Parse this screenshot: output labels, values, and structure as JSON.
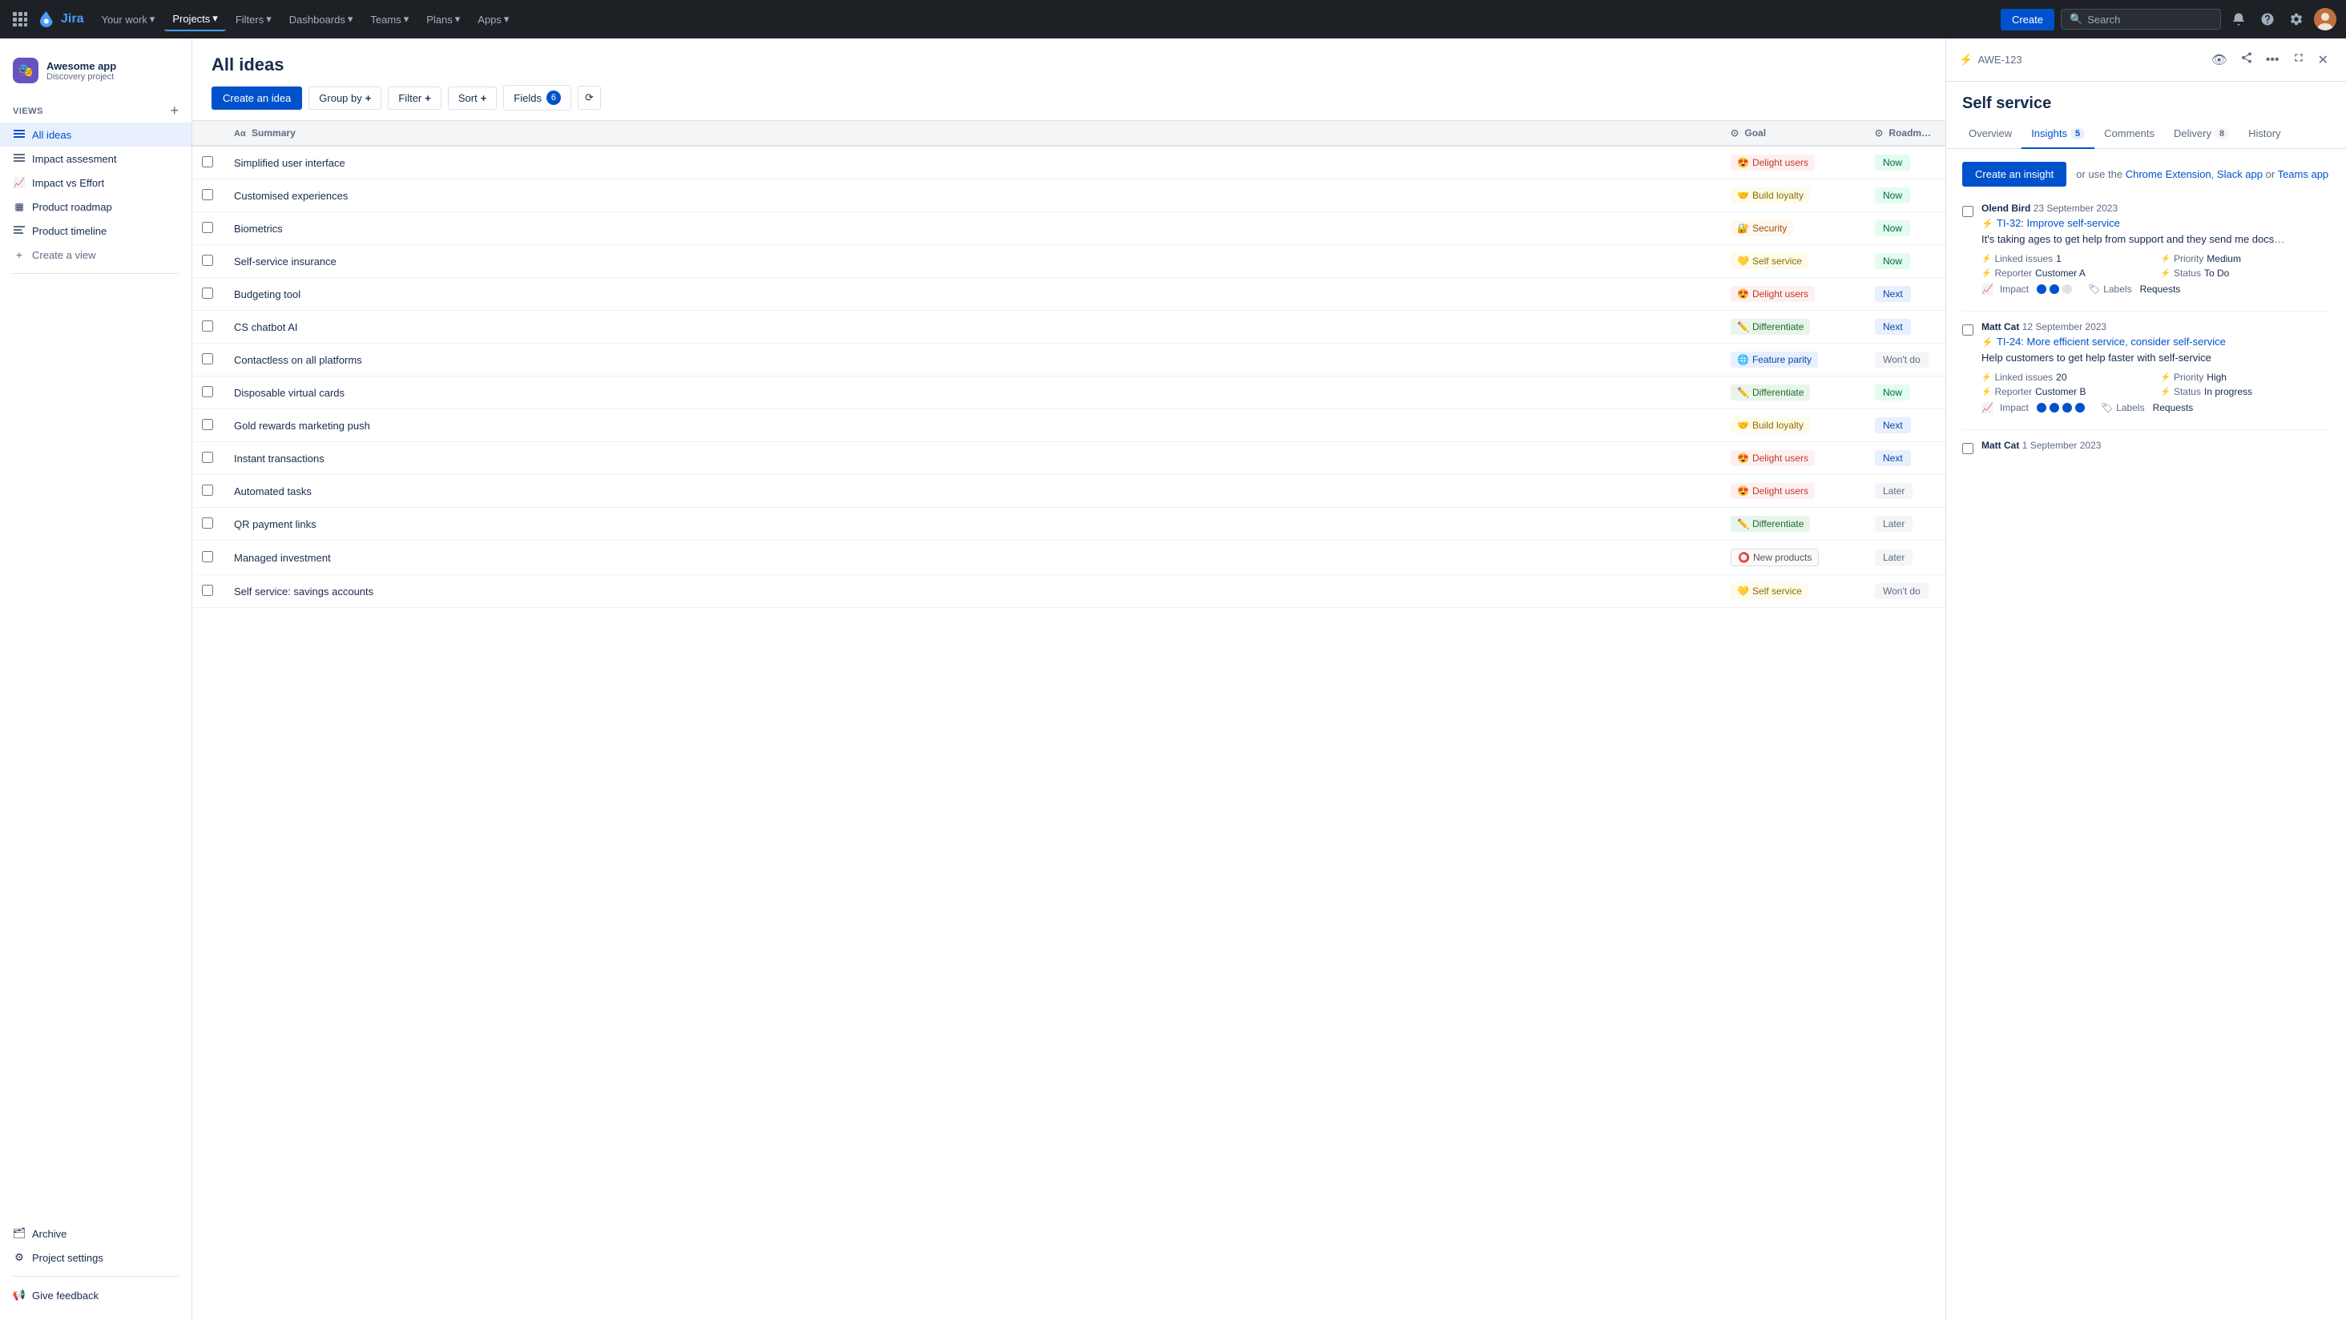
{
  "topnav": {
    "logo_text": "Jira",
    "nav_items": [
      {
        "label": "Your work",
        "dropdown": true
      },
      {
        "label": "Projects",
        "dropdown": true
      },
      {
        "label": "Filters",
        "dropdown": true
      },
      {
        "label": "Dashboards",
        "dropdown": true
      },
      {
        "label": "Teams",
        "dropdown": true
      },
      {
        "label": "Plans",
        "dropdown": true
      },
      {
        "label": "Apps",
        "dropdown": true
      }
    ],
    "create_label": "Create",
    "search_placeholder": "Search"
  },
  "sidebar": {
    "project_icon": "🎭",
    "project_name": "Awesome app",
    "project_sub": "Discovery project",
    "views_label": "VIEWS",
    "views_add_icon": "+",
    "nav_items": [
      {
        "id": "all-ideas",
        "label": "All ideas",
        "icon": "≡",
        "active": true
      },
      {
        "id": "impact-assessment",
        "label": "Impact assesment",
        "icon": "≡"
      },
      {
        "id": "impact-vs-effort",
        "label": "Impact vs Effort",
        "icon": "📈"
      },
      {
        "id": "product-roadmap",
        "label": "Product roadmap",
        "icon": "▦"
      },
      {
        "id": "product-timeline",
        "label": "Product timeline",
        "icon": "≡"
      },
      {
        "id": "create-view",
        "label": "Create a view",
        "icon": "+"
      }
    ],
    "bottom_items": [
      {
        "id": "archive",
        "label": "Archive",
        "icon": "🗂"
      },
      {
        "id": "project-settings",
        "label": "Project settings",
        "icon": "⚙"
      },
      {
        "id": "give-feedback",
        "label": "Give feedback",
        "icon": "📢"
      }
    ]
  },
  "main": {
    "title": "All ideas",
    "toolbar": {
      "create_idea": "Create an idea",
      "group_by": "Group by",
      "filter": "Filter",
      "sort": "Sort",
      "fields": "Fields",
      "fields_count": "6"
    },
    "table": {
      "columns": [
        "",
        "Summary",
        "Goal",
        "Roadmap"
      ],
      "rows": [
        {
          "summary": "Simplified user interface",
          "goal": "Delight users",
          "goal_class": "goal-delight",
          "goal_emoji": "😍",
          "roadmap": "Now",
          "roadmap_class": "roadmap-now"
        },
        {
          "summary": "Customised experiences",
          "goal": "Build loyalty",
          "goal_class": "goal-loyalty",
          "goal_emoji": "🤝",
          "roadmap": "Now",
          "roadmap_class": "roadmap-now"
        },
        {
          "summary": "Biometrics",
          "goal": "Security",
          "goal_class": "goal-security",
          "goal_emoji": "🔐",
          "roadmap": "Now",
          "roadmap_class": "roadmap-now"
        },
        {
          "summary": "Self-service insurance",
          "goal": "Self service",
          "goal_class": "goal-selfservice",
          "goal_emoji": "💛",
          "roadmap": "Now",
          "roadmap_class": "roadmap-now"
        },
        {
          "summary": "Budgeting tool",
          "goal": "Delight users",
          "goal_class": "goal-delight",
          "goal_emoji": "😍",
          "roadmap": "Next",
          "roadmap_class": "roadmap-next"
        },
        {
          "summary": "CS chatbot AI",
          "goal": "Differentiate",
          "goal_class": "goal-differentiate",
          "goal_emoji": "✏️",
          "roadmap": "Next",
          "roadmap_class": "roadmap-next"
        },
        {
          "summary": "Contactless on all platforms",
          "goal": "Feature parity",
          "goal_class": "goal-featureparity",
          "goal_emoji": "🌐",
          "roadmap": "Won't do",
          "roadmap_class": "roadmap-wontdo"
        },
        {
          "summary": "Disposable virtual cards",
          "goal": "Differentiate",
          "goal_class": "goal-differentiate",
          "goal_emoji": "✏️",
          "roadmap": "Now",
          "roadmap_class": "roadmap-now"
        },
        {
          "summary": "Gold rewards marketing push",
          "goal": "Build loyalty",
          "goal_class": "goal-loyalty",
          "goal_emoji": "🤝",
          "roadmap": "Next",
          "roadmap_class": "roadmap-next"
        },
        {
          "summary": "Instant transactions",
          "goal": "Delight users",
          "goal_class": "goal-delight",
          "goal_emoji": "😍",
          "roadmap": "Next",
          "roadmap_class": "roadmap-next"
        },
        {
          "summary": "Automated tasks",
          "goal": "Delight users",
          "goal_class": "goal-delight",
          "goal_emoji": "😍",
          "roadmap": "Later",
          "roadmap_class": "roadmap-later"
        },
        {
          "summary": "QR payment links",
          "goal": "Differentiate",
          "goal_class": "goal-differentiate",
          "goal_emoji": "✏️",
          "roadmap": "Later",
          "roadmap_class": "roadmap-later"
        },
        {
          "summary": "Managed investment",
          "goal": "New products",
          "goal_class": "goal-newproducts",
          "goal_emoji": "⭕",
          "roadmap": "Later",
          "roadmap_class": "roadmap-later"
        },
        {
          "summary": "Self service: savings accounts",
          "goal": "Self service",
          "goal_class": "goal-selfservice",
          "goal_emoji": "💛",
          "roadmap": "Won't do",
          "roadmap_class": "roadmap-wontdo"
        }
      ]
    }
  },
  "detail": {
    "issue_id": "AWE-123",
    "title": "Self service",
    "tabs": [
      {
        "id": "overview",
        "label": "Overview",
        "badge": null,
        "active": false
      },
      {
        "id": "insights",
        "label": "Insights",
        "badge": "5",
        "active": true
      },
      {
        "id": "comments",
        "label": "Comments",
        "badge": null,
        "active": false
      },
      {
        "id": "delivery",
        "label": "Delivery",
        "badge": "8",
        "active": false
      },
      {
        "id": "history",
        "label": "History",
        "badge": null,
        "active": false
      }
    ],
    "insights_tab": {
      "create_btn": "Create an insight",
      "or_text": "or use the",
      "chrome_text": "Chrome Extension",
      "comma": ",",
      "slack_text": "Slack app",
      "or2": "or",
      "teams_text": "Teams app",
      "items": [
        {
          "author": "Olend Bird",
          "date": "23 September 2023",
          "link_id": "TI-32",
          "link_text": "TI-32: Improve self-service",
          "description": "It's taking ages to get help from support and they send me docs...",
          "linked_issues": "1",
          "priority": "Medium",
          "reporter": "Customer A",
          "status": "To Do",
          "impact_dots": 2,
          "labels": "Requests"
        },
        {
          "author": "Matt Cat",
          "date": "12 September 2023",
          "link_id": "TI-24",
          "link_text": "TI-24: More efficient service, consider self-service",
          "description": "Help customers to get help faster with self-service",
          "linked_issues": "20",
          "priority": "High",
          "reporter": "Customer B",
          "status": "In progress",
          "impact_dots": 4,
          "labels": "Requests"
        },
        {
          "author": "Matt Cat",
          "date": "1 September 2023",
          "link_text": null
        }
      ]
    }
  },
  "colors": {
    "accent": "#0052cc",
    "sidebar_active_bg": "#e8f0fe",
    "topnav_bg": "#1d2125"
  }
}
